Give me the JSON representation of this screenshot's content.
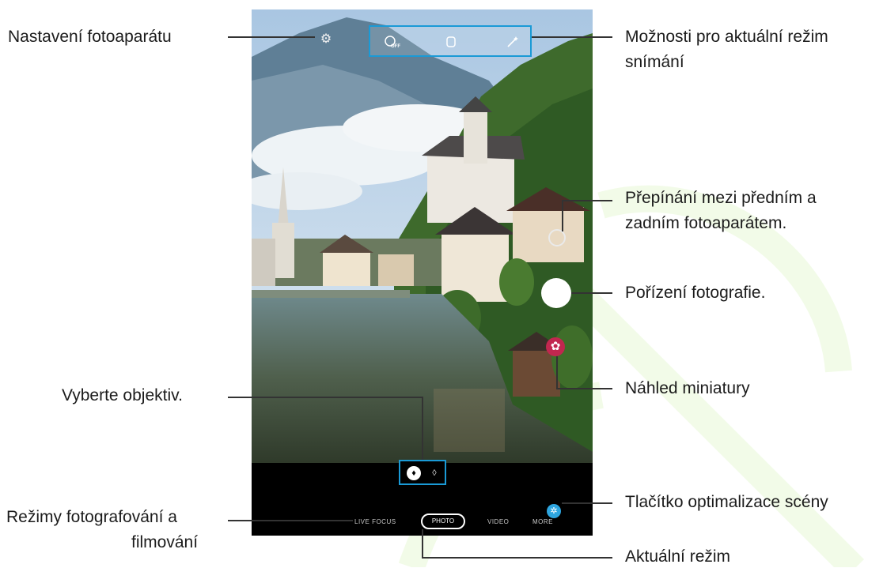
{
  "colors": {
    "highlight": "#1a9ad6",
    "thumbnail": "#c1274f",
    "scene_optimizer": "#2ea6e0",
    "watermark": "#7ed321"
  },
  "icons": {
    "settings": "gear-icon",
    "flash": "flash-off-icon",
    "timer": "timer-icon",
    "filter": "magic-wand-icon",
    "switch_camera": "switch-camera-icon",
    "thumbnail": "flower-icon",
    "lens_wide": "wide-lens-icon",
    "lens_ultra": "ultra-wide-lens-icon",
    "scene_optimizer": "scene-optimizer-icon"
  },
  "camera": {
    "flash_label": "OFF",
    "modes": [
      "LIVE FOCUS",
      "PHOTO",
      "VIDEO",
      "MORE"
    ],
    "current_mode": "PHOTO"
  },
  "callouts": {
    "settings": "Nastavení fotoaparátu",
    "options_line1": "Možnosti pro aktuální režim",
    "options_line2": "snímání",
    "switch_line1": "Přepínání mezi předním a",
    "switch_line2": "zadním fotoaparátem.",
    "shutter": "Pořízení fotografie.",
    "preview": "Náhled miniatury",
    "lens": "Vyberte objektiv.",
    "scene_optimizer": "Tlačítko optimalizace scény",
    "modes_line1": "Režimy fotografování a",
    "modes_line2": "filmování",
    "current_mode": "Aktuální režim"
  }
}
